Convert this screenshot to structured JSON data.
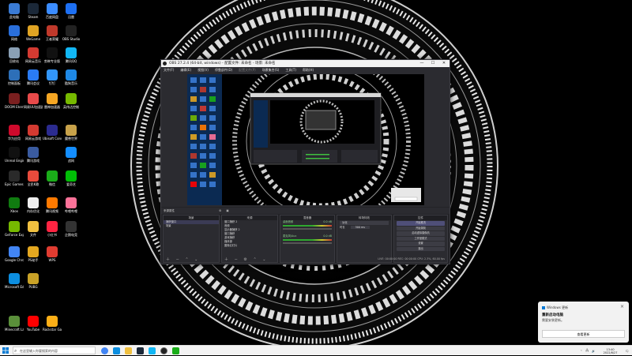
{
  "desktop_icons": [
    {
      "label": "此电脑",
      "color": "#3a7bd5"
    },
    {
      "label": "Steam",
      "color": "#1b2838"
    },
    {
      "label": "百度网盘",
      "color": "#3b8cff"
    },
    {
      "label": "网络",
      "color": "#2a6fdb"
    },
    {
      "label": "WeGame",
      "color": "#e0a423"
    },
    {
      "label": "王者荣耀",
      "color": "#c0392b"
    },
    {
      "label": "OBS Studio",
      "color": "#222222"
    },
    {
      "label": "回收站",
      "color": "#8aa0b5"
    },
    {
      "label": "网易云音乐",
      "color": "#d33a31"
    },
    {
      "label": "剪映专业版",
      "color": "#111111"
    },
    {
      "label": "迅雷",
      "color": "#1d6ff2"
    },
    {
      "label": "控制面板",
      "color": "#2d6fb8"
    },
    {
      "label": "腾讯会议",
      "color": "#2a7bf4"
    },
    {
      "label": "钉钉",
      "color": "#3296fa"
    },
    {
      "label": "酷狗音乐",
      "color": "#1e88e5"
    },
    {
      "label": "DOOM Eternal",
      "color": "#7a1f1f"
    },
    {
      "label": "网易UU加速器",
      "color": "#e84a4a"
    },
    {
      "label": "雷神加速器",
      "color": "#f5a623"
    },
    {
      "label": "腾讯QQ",
      "color": "#12b7f5"
    },
    {
      "label": "英伟达控制",
      "color": "#76b900"
    },
    {
      "label": "华为应用",
      "color": "#cf0a2c"
    },
    {
      "label": "Ubisoft Connect",
      "color": "#2b2b8f"
    },
    {
      "label": "魔兽世界",
      "color": "#c8a24a"
    },
    {
      "label": "Unreal Engine",
      "color": "#111111"
    },
    {
      "label": "网易云游戏",
      "color": "#d33a31"
    },
    {
      "label": "腾讯游戏",
      "color": "#3a5ba0"
    },
    {
      "label": "战网",
      "color": "#148eff"
    },
    {
      "label": "Epic Games Launcher",
      "color": "#2a2a2a"
    },
    {
      "label": "全民K歌",
      "color": "#e94b3c"
    },
    {
      "label": "微信",
      "color": "#1aad19"
    },
    {
      "label": "爱奇艺",
      "color": "#00be06"
    },
    {
      "label": "Xbox",
      "color": "#107c10"
    },
    {
      "label": "内存优化",
      "color": "#eeeeee"
    },
    {
      "label": "腾讯视频",
      "color": "#ff7a00"
    },
    {
      "label": "哔哩哔哩",
      "color": "#fb7299"
    },
    {
      "label": "GeForce Experience",
      "color": "#76b900"
    },
    {
      "label": "文件",
      "color": "#f0c040"
    },
    {
      "label": "小红书",
      "color": "#ff2442"
    },
    {
      "label": "企鹅电竞",
      "color": "#333333"
    },
    {
      "label": "Google Chrome",
      "color": "#4285f4"
    },
    {
      "label": "PS助手",
      "color": "#e5a820"
    },
    {
      "label": "WPS",
      "color": "#e03c31"
    },
    {
      "label": "Microsoft Edge",
      "color": "#0c8ee0"
    },
    {
      "label": "PUBG",
      "color": "#c9a227"
    },
    {
      "label": "Minecraft Launcher",
      "color": "#5a8f3a"
    },
    {
      "label": "YouTube",
      "color": "#ff0000"
    },
    {
      "label": "Rockstar Games",
      "color": "#fcaf17"
    }
  ],
  "obs": {
    "title": "OBS 27.2.4 (64-bit, windows) - 配置文件: 未命名 - 场景: 未命名",
    "menu": [
      "文件(F)",
      "编辑(E)",
      "视图(V)",
      "停靠部件(D)",
      "配置文件(P)",
      "场景集合(S)",
      "工具(T)",
      "帮助(H)"
    ],
    "scene_line": "来源属性",
    "docks": {
      "scenes": {
        "header": "场景",
        "items": [
          "捕获窗口",
          "场景"
        ]
      },
      "sources": {
        "header": "来源",
        "items": [
          "窗口捕获 2",
          "音频",
          "显示器捕获 2",
          "窗口捕获",
          "游戏捕获",
          "媒体源",
          "图像幻灯片"
        ]
      },
      "mixer": {
        "header": "混音器",
        "tracks": [
          {
            "name": "桌面音频",
            "db": "0.0 dB"
          },
          {
            "name": "麦克风/Aux",
            "db": "0.0 dB"
          }
        ]
      },
      "transitions": {
        "header": "转场特效",
        "type": "淡化",
        "duration_label": "时长",
        "duration": "300 ms"
      },
      "controls": {
        "header": "控件",
        "buttons": [
          "开始推流",
          "开始录制",
          "启动虚拟摄像机",
          "工作室模式",
          "设置",
          "退出"
        ]
      }
    },
    "status": "LIVE: 00:00:00   REC: 00:00:00   CPU: 2.3%, 60.00 fps"
  },
  "toast": {
    "app": "Windows 更新",
    "title": "重新启动电脑",
    "body": "需要安装更新。",
    "button": "查看更新"
  },
  "taskbar": {
    "search_placeholder": "在这里输入你要搜索的内容",
    "clock_time": "13:40",
    "clock_date": "2022/8/27"
  }
}
